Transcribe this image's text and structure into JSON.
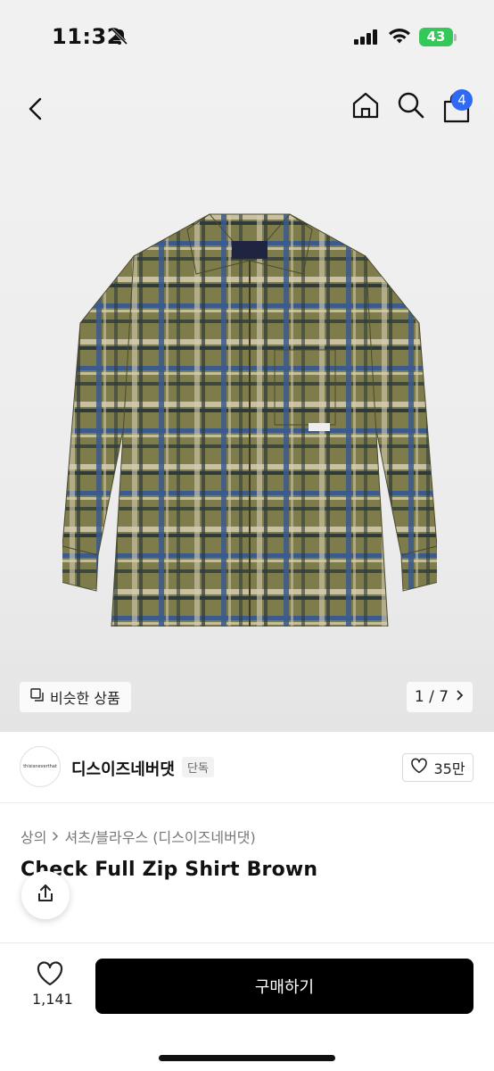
{
  "status_bar": {
    "time": "11:32",
    "battery": "43"
  },
  "nav": {
    "cart_count": "4"
  },
  "gallery": {
    "similar_label": "비슷한 상품",
    "pager": "1 / 7"
  },
  "brand": {
    "name": "디스이즈네버댓",
    "tag": "단독",
    "logo_text": "thisisneverthat",
    "likes": "35만"
  },
  "breadcrumb": [
    "상의",
    "셔츠/블라우스 (디스이즈네버댓)"
  ],
  "product": {
    "title": "Check Full Zip Shirt Brown"
  },
  "bottom": {
    "wish_count": "1,141",
    "buy_label": "구매하기"
  },
  "colors": {
    "accent": "#2f6af5",
    "battery": "#34c759",
    "buy_button": "#000000"
  }
}
